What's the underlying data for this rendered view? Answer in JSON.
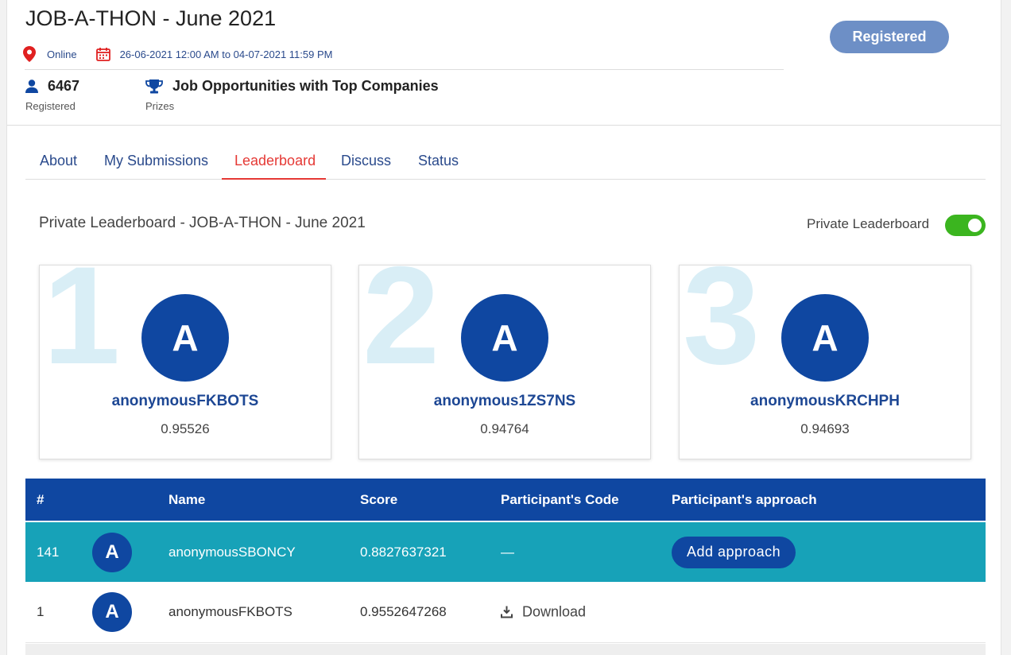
{
  "event": {
    "title": "JOB-A-THON - June 2021",
    "location": "Online",
    "dates": "26-06-2021 12:00 AM to 04-07-2021 11:59 PM",
    "registered_button": "Registered"
  },
  "stats": {
    "registered_count": "6467",
    "registered_label": "Registered",
    "prizes_value": "Job Opportunities with Top Companies",
    "prizes_label": "Prizes"
  },
  "tabs": [
    {
      "label": "About"
    },
    {
      "label": "My Submissions"
    },
    {
      "label": "Leaderboard",
      "active": true
    },
    {
      "label": "Discuss"
    },
    {
      "label": "Status"
    }
  ],
  "leaderboard": {
    "heading": "Private Leaderboard - JOB-A-THON - June 2021",
    "toggle_label": "Private Leaderboard",
    "toggle_on": true,
    "podium": [
      {
        "rank": "1",
        "initial": "A",
        "name": "anonymousFKBOTS",
        "score": "0.95526"
      },
      {
        "rank": "2",
        "initial": "A",
        "name": "anonymous1ZS7NS",
        "score": "0.94764"
      },
      {
        "rank": "3",
        "initial": "A",
        "name": "anonymousKRCHPH",
        "score": "0.94693"
      }
    ],
    "columns": {
      "rank": "#",
      "name": "Name",
      "score": "Score",
      "code": "Participant's Code",
      "approach": "Participant's approach"
    },
    "rows": [
      {
        "rank": "141",
        "initial": "A",
        "name": "anonymousSBONCY",
        "score": "0.8827637321",
        "code": "—",
        "approach": "Add approach"
      },
      {
        "rank": "1",
        "initial": "A",
        "name": "anonymousFKBOTS",
        "score": "0.9552647268",
        "code": "Download",
        "approach": ""
      }
    ]
  },
  "colors": {
    "primary": "#0f47a1",
    "highlight_row": "#17a2b8",
    "active_tab": "#e53935",
    "toggle": "#3bb51f",
    "registered_btn": "#6d8fc6"
  }
}
